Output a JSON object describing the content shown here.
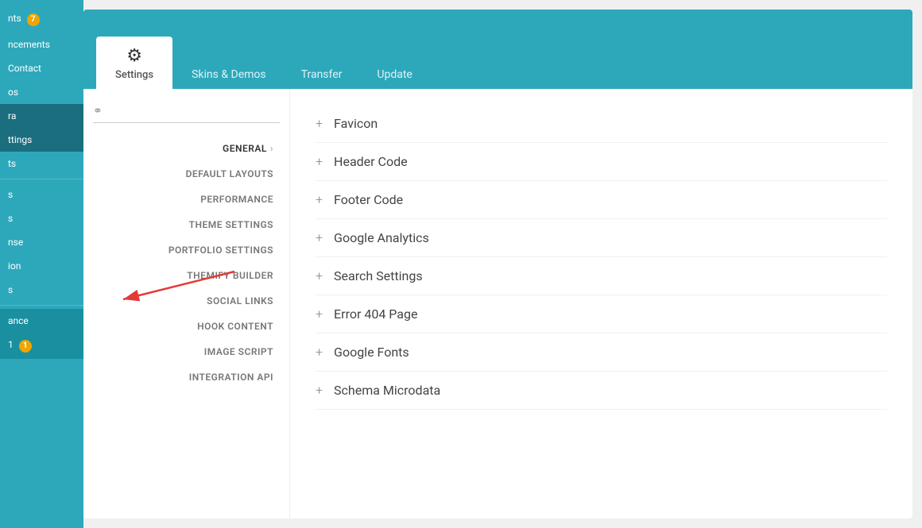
{
  "sidebar": {
    "items": [
      {
        "label": "nts",
        "badge": "7",
        "active": false
      },
      {
        "label": "ncements",
        "active": false
      },
      {
        "label": "Contact",
        "active": false
      },
      {
        "label": "os",
        "active": false
      },
      {
        "label": "ra",
        "active": true,
        "highlighted": true
      },
      {
        "label": "ttings",
        "active": false
      },
      {
        "label": "ts",
        "active": false
      },
      {
        "label": "s",
        "active": false
      },
      {
        "label": "s",
        "active": false
      },
      {
        "label": "nse",
        "active": false
      },
      {
        "label": "ion",
        "active": false
      },
      {
        "label": "s",
        "active": false
      },
      {
        "label": "ance",
        "active": false
      },
      {
        "label": "1",
        "badge": "1",
        "active": false
      }
    ]
  },
  "tabs": [
    {
      "label": "Settings",
      "icon": "⚙",
      "active": true
    },
    {
      "label": "Skins & Demos",
      "active": false
    },
    {
      "label": "Transfer",
      "active": false
    },
    {
      "label": "Update",
      "active": false
    }
  ],
  "search": {
    "placeholder": ""
  },
  "settings_nav": [
    {
      "label": "GENERAL",
      "chevron": true,
      "active": true
    },
    {
      "label": "DEFAULT LAYOUTS",
      "chevron": false
    },
    {
      "label": "PERFORMANCE",
      "chevron": false
    },
    {
      "label": "THEME SETTINGS",
      "chevron": false
    },
    {
      "label": "PORTFOLIO SETTINGS",
      "chevron": false
    },
    {
      "label": "THEMIFY BUILDER",
      "chevron": false
    },
    {
      "label": "SOCIAL LINKS",
      "chevron": false
    },
    {
      "label": "HOOK CONTENT",
      "chevron": false
    },
    {
      "label": "IMAGE SCRIPT",
      "chevron": false
    },
    {
      "label": "INTEGRATION API",
      "chevron": false
    }
  ],
  "settings_entries": [
    {
      "label": "Favicon"
    },
    {
      "label": "Header Code"
    },
    {
      "label": "Footer Code"
    },
    {
      "label": "Google Analytics"
    },
    {
      "label": "Search Settings"
    },
    {
      "label": "Error 404 Page"
    },
    {
      "label": "Google Fonts"
    },
    {
      "label": "Schema Microdata"
    }
  ]
}
